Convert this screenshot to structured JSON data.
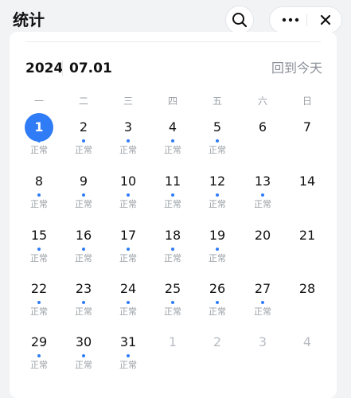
{
  "header": {
    "title": "统计",
    "search_icon": "search-icon",
    "more_icon": "more-icon",
    "close_icon": "close-icon"
  },
  "calendar": {
    "year": "2024",
    "month": "07.01",
    "today_link": "回到今天",
    "weekdays": [
      "一",
      "二",
      "三",
      "四",
      "五",
      "六",
      "日"
    ],
    "accent_color": "#2f7cf6",
    "weeks": [
      [
        {
          "day": "1",
          "status": "正常",
          "dot": true,
          "today": true,
          "other": false
        },
        {
          "day": "2",
          "status": "正常",
          "dot": true,
          "today": false,
          "other": false
        },
        {
          "day": "3",
          "status": "正常",
          "dot": true,
          "today": false,
          "other": false
        },
        {
          "day": "4",
          "status": "正常",
          "dot": true,
          "today": false,
          "other": false
        },
        {
          "day": "5",
          "status": "正常",
          "dot": true,
          "today": false,
          "other": false
        },
        {
          "day": "6",
          "status": "",
          "dot": false,
          "today": false,
          "other": false
        },
        {
          "day": "7",
          "status": "",
          "dot": false,
          "today": false,
          "other": false
        }
      ],
      [
        {
          "day": "8",
          "status": "正常",
          "dot": true,
          "today": false,
          "other": false
        },
        {
          "day": "9",
          "status": "正常",
          "dot": true,
          "today": false,
          "other": false
        },
        {
          "day": "10",
          "status": "正常",
          "dot": true,
          "today": false,
          "other": false
        },
        {
          "day": "11",
          "status": "正常",
          "dot": true,
          "today": false,
          "other": false
        },
        {
          "day": "12",
          "status": "正常",
          "dot": true,
          "today": false,
          "other": false
        },
        {
          "day": "13",
          "status": "正常",
          "dot": true,
          "today": false,
          "other": false
        },
        {
          "day": "14",
          "status": "",
          "dot": false,
          "today": false,
          "other": false
        }
      ],
      [
        {
          "day": "15",
          "status": "正常",
          "dot": true,
          "today": false,
          "other": false
        },
        {
          "day": "16",
          "status": "正常",
          "dot": true,
          "today": false,
          "other": false
        },
        {
          "day": "17",
          "status": "正常",
          "dot": true,
          "today": false,
          "other": false
        },
        {
          "day": "18",
          "status": "正常",
          "dot": true,
          "today": false,
          "other": false
        },
        {
          "day": "19",
          "status": "正常",
          "dot": true,
          "today": false,
          "other": false
        },
        {
          "day": "20",
          "status": "",
          "dot": false,
          "today": false,
          "other": false
        },
        {
          "day": "21",
          "status": "",
          "dot": false,
          "today": false,
          "other": false
        }
      ],
      [
        {
          "day": "22",
          "status": "正常",
          "dot": true,
          "today": false,
          "other": false
        },
        {
          "day": "23",
          "status": "正常",
          "dot": true,
          "today": false,
          "other": false
        },
        {
          "day": "24",
          "status": "正常",
          "dot": true,
          "today": false,
          "other": false
        },
        {
          "day": "25",
          "status": "正常",
          "dot": true,
          "today": false,
          "other": false
        },
        {
          "day": "26",
          "status": "正常",
          "dot": true,
          "today": false,
          "other": false
        },
        {
          "day": "27",
          "status": "正常",
          "dot": true,
          "today": false,
          "other": false
        },
        {
          "day": "28",
          "status": "",
          "dot": false,
          "today": false,
          "other": false
        }
      ],
      [
        {
          "day": "29",
          "status": "正常",
          "dot": true,
          "today": false,
          "other": false
        },
        {
          "day": "30",
          "status": "正常",
          "dot": true,
          "today": false,
          "other": false
        },
        {
          "day": "31",
          "status": "正常",
          "dot": true,
          "today": false,
          "other": false
        },
        {
          "day": "1",
          "status": "",
          "dot": false,
          "today": false,
          "other": true
        },
        {
          "day": "2",
          "status": "",
          "dot": false,
          "today": false,
          "other": true
        },
        {
          "day": "3",
          "status": "",
          "dot": false,
          "today": false,
          "other": true
        },
        {
          "day": "4",
          "status": "",
          "dot": false,
          "today": false,
          "other": true
        }
      ]
    ]
  }
}
